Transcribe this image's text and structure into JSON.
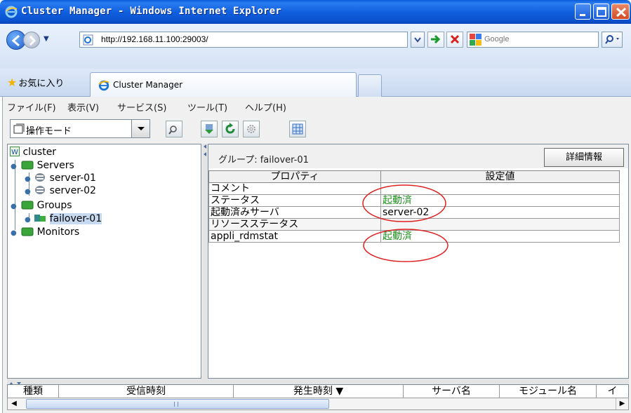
{
  "window": {
    "title": "Cluster Manager - Windows Internet Explorer"
  },
  "address_bar": {
    "url": "http://192.168.11.100:29003/",
    "search_placeholder": "Google"
  },
  "favorites": {
    "label": "お気に入り"
  },
  "tabs": [
    {
      "label": "Cluster Manager",
      "active": true
    }
  ],
  "menu": {
    "items": [
      "ファイル(F)",
      "表示(V)",
      "サービス(S)",
      "ツール(T)",
      "ヘルプ(H)"
    ]
  },
  "toolbar": {
    "mode_label": "操作モード"
  },
  "tree": {
    "root": "cluster",
    "nodes": {
      "servers": "Servers",
      "server01": "server-01",
      "server02": "server-02",
      "groups": "Groups",
      "failover01": "failover-01",
      "monitors": "Monitors"
    }
  },
  "detail": {
    "title": "グループ: failover-01",
    "details_button": "詳細情報",
    "columns": [
      "プロパティ",
      "設定値"
    ],
    "rows": [
      {
        "property": "コメント",
        "value": ""
      },
      {
        "property": "ステータス",
        "value": "起動済"
      },
      {
        "property": "起動済みサーバ",
        "value": "server-02"
      },
      {
        "property": "リソースステータス",
        "value": ""
      },
      {
        "property": "appli_rdmstat",
        "value": "起動済"
      }
    ]
  },
  "alert_log": {
    "columns": [
      "種類",
      "受信時刻",
      "発生時刻 ▼",
      "サーバ名",
      "モジュール名",
      "イ"
    ]
  },
  "colors": {
    "status_ok": "#1e8e1e",
    "annotation": "#e02020",
    "title_bar": "#1160e0"
  }
}
